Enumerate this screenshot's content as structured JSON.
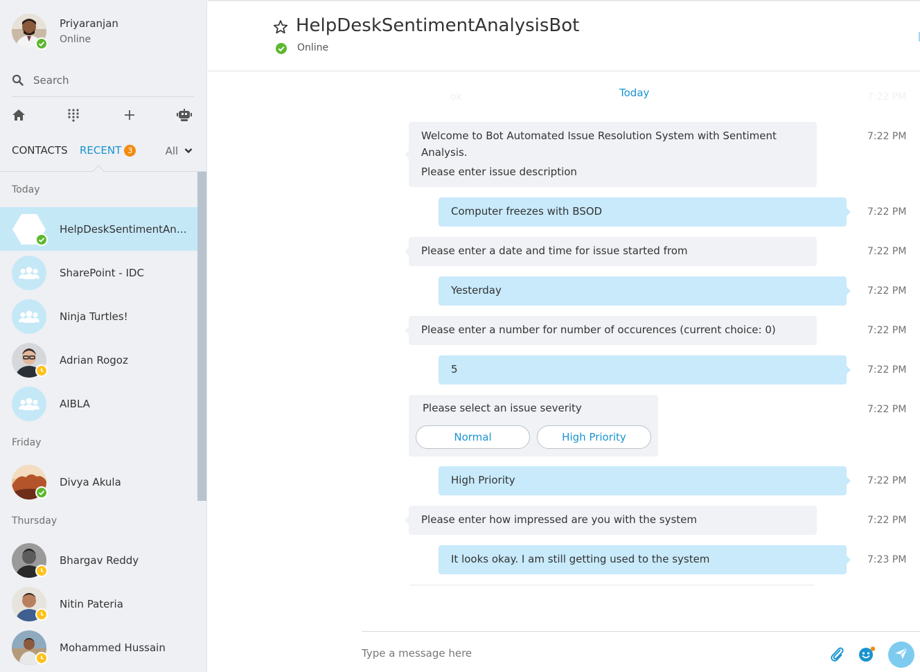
{
  "profile": {
    "name": "Priyaranjan",
    "status": "Online"
  },
  "search": {
    "placeholder": "Search"
  },
  "tabs": {
    "contacts": "CONTACTS",
    "recent": "RECENT",
    "recent_badge": "3",
    "filter": "All"
  },
  "sections": {
    "today": "Today",
    "friday": "Friday",
    "thursday": "Thursday"
  },
  "contacts": [
    {
      "name": "HelpDeskSentimentAnal...",
      "status": "online"
    },
    {
      "name": "SharePoint - IDC"
    },
    {
      "name": "Ninja Turtles!"
    },
    {
      "name": "Adrian Rogoz",
      "status": "away"
    },
    {
      "name": "AIBLA"
    },
    {
      "name": "Divya Akula",
      "status": "online"
    },
    {
      "name": "Bhargav Reddy",
      "status": "away"
    },
    {
      "name": "Nitin Pateria",
      "status": "away"
    },
    {
      "name": "Mohammed Hussain",
      "status": "away"
    }
  ],
  "chat": {
    "title": "HelpDeskSentimentAnalysisBot",
    "status": "Online",
    "ghost_text": "ok",
    "ghost_time": "7:22 PM",
    "day_separator": "Today",
    "messages": [
      {
        "line1": "Welcome to Bot Automated Issue Resolution System with Sentiment",
        "line2": "Analysis.",
        "line3": "Please enter issue description",
        "time": "7:22 PM"
      },
      {
        "text": "Computer freezes with BSOD",
        "time": "7:22 PM"
      },
      {
        "text": "Please enter a date and time for issue started from",
        "time": "7:22 PM"
      },
      {
        "text": "Yesterday",
        "time": "7:22 PM"
      },
      {
        "text": "Please enter a number for number of occurences (current choice: 0)",
        "time": "7:22 PM"
      },
      {
        "text": "5",
        "time": "7:22 PM"
      },
      {
        "text": "Please select an issue severity",
        "time": "7:22 PM",
        "options": [
          "Normal",
          "High Priority"
        ]
      },
      {
        "text": "High Priority",
        "time": "7:22 PM"
      },
      {
        "text": "Please enter how impressed are you with the system",
        "time": "7:22 PM"
      },
      {
        "text": "It looks okay. I am still getting used to the system",
        "time": "7:23 PM"
      }
    ]
  },
  "composer": {
    "placeholder": "Type a message here"
  },
  "colors": {
    "accent": "#1a93d0",
    "online": "#5cb82e",
    "away": "#ffc21b",
    "badge": "#f28b0e",
    "outgoing": "#c8eafb",
    "incoming": "#f0f2f5"
  }
}
